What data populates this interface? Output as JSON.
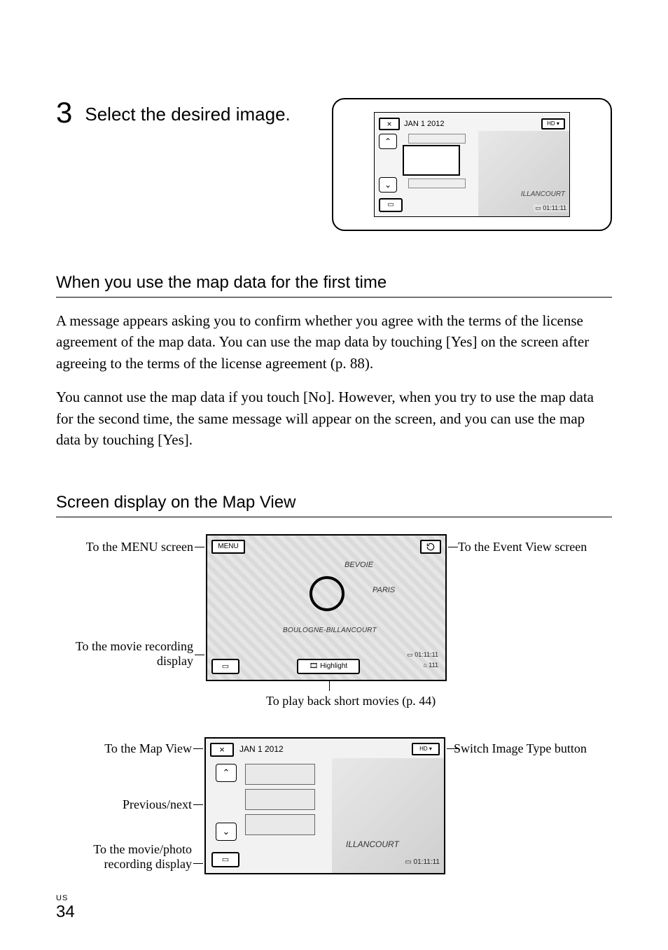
{
  "step": {
    "number": "3",
    "text": "Select the desired image."
  },
  "thumb_screen": {
    "close_glyph": "×",
    "date": "JAN 1 2012",
    "hd_label": "HD ▾",
    "up_glyph": "⌃",
    "down_glyph": "⌄",
    "rec_glyph": "▭",
    "map_text": "ILLANCOURT",
    "duration": "▭ 01:11:11"
  },
  "section1": {
    "heading": "When you use the map data for the first time",
    "para1": "A message appears asking you to confirm whether you agree with the terms of the license agreement of the map data. You can use the map data by touching [Yes] on the screen after agreeing to the terms of the license agreement (p. 88).",
    "para2": "You cannot use the map data if you touch [No]. However, when you try to use the map data for the second time, the same message will appear on the screen, and you can use the map data by touching [Yes]."
  },
  "section2": {
    "heading": "Screen display on the Map View"
  },
  "diagram1": {
    "label_menu": "To the MENU screen",
    "label_rec": "To the movie recording display",
    "label_event": "To the Event View screen",
    "label_playback": "To play back short movies (p. 44)",
    "menu_btn": "MENU",
    "highlight_btn": "🎞 Highlight",
    "rec_glyph": "▭",
    "map_text1": "BEVOIE",
    "map_text2": "PARIS",
    "map_text3": "BOULOGNE-BILLANCOURT",
    "duration1": "▭ 01:11:11",
    "duration2": "⌂ 111"
  },
  "diagram2": {
    "label_mapview": "To the Map View",
    "label_prevnext": "Previous/next",
    "label_recdisp": "To the movie/photo recording display",
    "label_switch": "Switch Image Type button",
    "close_glyph": "×",
    "date": "JAN 1 2012",
    "hd_label": "HD ▾",
    "up_glyph": "⌃",
    "down_glyph": "⌄",
    "rec_glyph": "▭",
    "map_text": "ILLANCOURT",
    "duration": "▭ 01:11:11"
  },
  "footer": {
    "region": "US",
    "page": "34"
  }
}
